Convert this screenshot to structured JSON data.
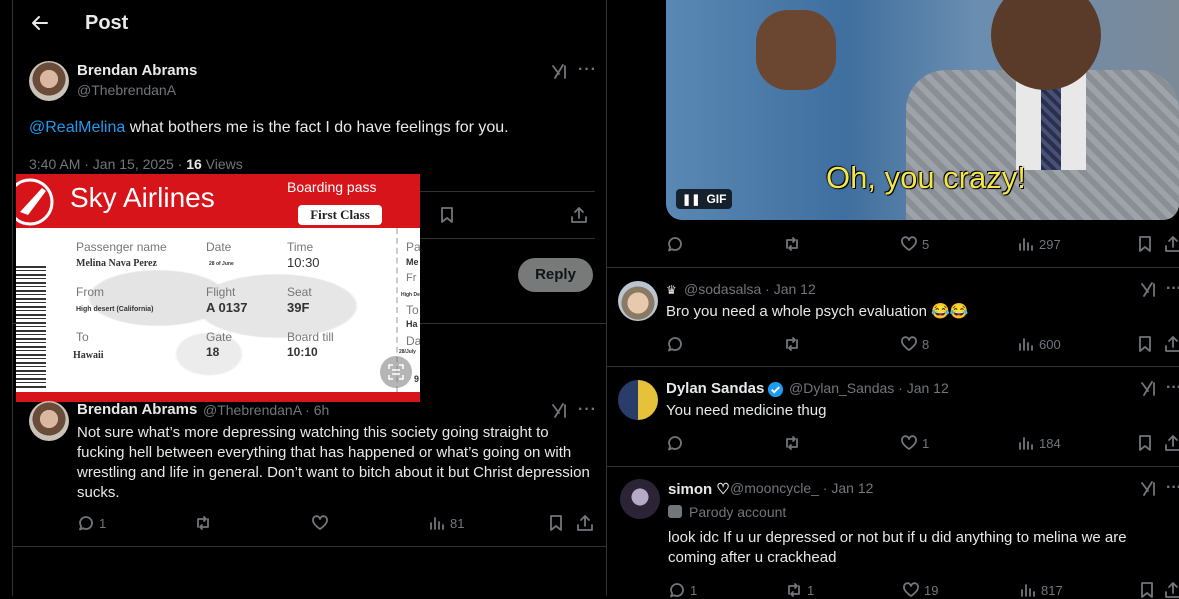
{
  "header": {
    "title": "Post"
  },
  "main_post": {
    "author_name": "Brendan Abrams",
    "author_handle": "@ThebrendanA",
    "mention": "@RealMelina",
    "text": " what bothers me is the fact I do have feelings for you.",
    "timestamp": "3:40 AM · Jan 15, 2025 · ",
    "views_count": "16",
    "views_label": " Views"
  },
  "reply_box": {
    "button_label": "Reply"
  },
  "boarding_pass": {
    "airline": "Sky Airlines",
    "pass_label": "Boarding pass",
    "class_label": "First Class",
    "fields": {
      "passenger_label": "Passenger name",
      "passenger": "Melina Nava Perez",
      "date_label": "Date",
      "date": "28 of June",
      "time_label": "Time",
      "time": "10:30",
      "from_label": "From",
      "from": "High desert (California)",
      "flight_label": "Flight",
      "flight": "A 0137",
      "seat_label": "Seat",
      "seat": "39F",
      "to_label": "To",
      "to": "Hawaii",
      "gate_label": "Gate",
      "gate": "18",
      "boardtill_label": "Board till",
      "boardtill": "10:10"
    },
    "stub": {
      "p": "Pa",
      "me": "Me",
      "fr": "Fr",
      "hd": "High De",
      "to": "To",
      "ha": "Ha",
      "da": "Da",
      "jul": "28/July",
      "nine": "9"
    }
  },
  "second_post": {
    "author_name": "Brendan Abrams",
    "author_handle": "@ThebrendanA · 6h",
    "text": "Not sure what’s more depressing watching this society going straight to fucking hell between everything that has happened or what’s going on with wrestling and life in general. Don’t want to bitch about it but Christ depression sucks.",
    "replies": "1",
    "views": "81"
  },
  "gif_post": {
    "gif_label": "GIF",
    "caption": "Oh, you crazy!",
    "likes": "5",
    "views": "297"
  },
  "replies": [
    {
      "name": "",
      "handle": "@sodasalsa · Jan 12",
      "text": "Bro you need a whole psych evaluation 😂😂",
      "replies": "",
      "retweets": "",
      "likes": "8",
      "views": "600"
    },
    {
      "name": "Dylan Sandas",
      "handle": "@Dylan_Sandas · Jan 12",
      "text": "You need medicine thug",
      "replies": "",
      "retweets": "",
      "likes": "1",
      "views": "184"
    },
    {
      "name": "simon ♡",
      "handle": "@mooncycle_ · Jan 12",
      "parody": "Parody account",
      "text": "look idc If u ur depressed or not but if u did anything to melina we are coming after u crackhead",
      "replies": "1",
      "retweets": "1",
      "likes": "19",
      "views": "817"
    }
  ],
  "colors": {
    "accent": "#1d9bf0",
    "background": "#000000",
    "muted": "#71767b",
    "airline_red": "#d7141a"
  }
}
